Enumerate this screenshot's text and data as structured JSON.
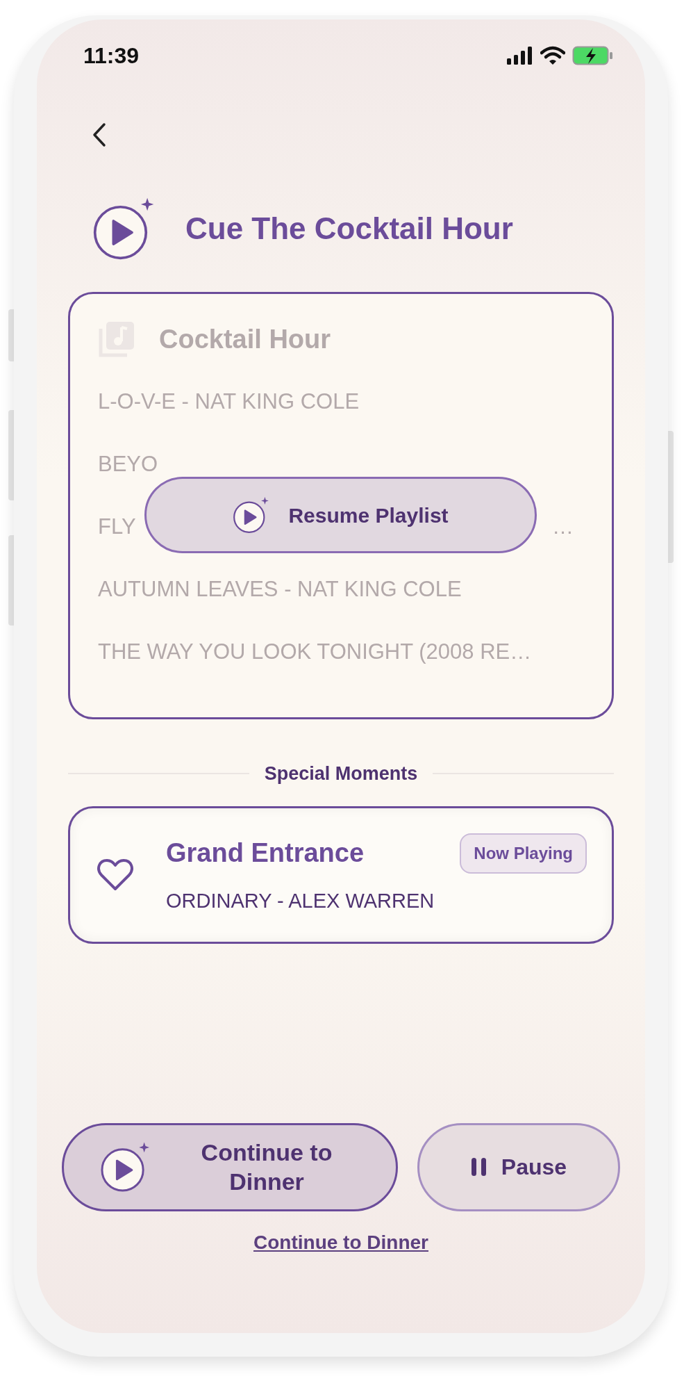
{
  "status_bar": {
    "time": "11:39"
  },
  "header": {
    "title": "Cue The Cocktail Hour"
  },
  "playlist": {
    "title": "Cocktail Hour",
    "dimmed": true,
    "overlay_button": "Resume Playlist",
    "tracks": [
      {
        "text": "L-O-V-E - NAT KING COLE"
      },
      {
        "text": "BEYO"
      },
      {
        "text": "FLY",
        "tail": "…"
      },
      {
        "text": "AUTUMN LEAVES - NAT KING COLE"
      },
      {
        "text": "THE WAY YOU LOOK TONIGHT (2008 RE…"
      }
    ]
  },
  "special_moments": {
    "heading": "Special Moments",
    "items": [
      {
        "title": "Grand Entrance",
        "subtitle": "ORDINARY - ALEX WARREN",
        "badge": "Now Playing"
      }
    ]
  },
  "actions": [
    {
      "label": "Continue to Dinner",
      "kind": "primary"
    },
    {
      "label": "Pause",
      "kind": "pause"
    }
  ],
  "link": "Continue to Dinner"
}
